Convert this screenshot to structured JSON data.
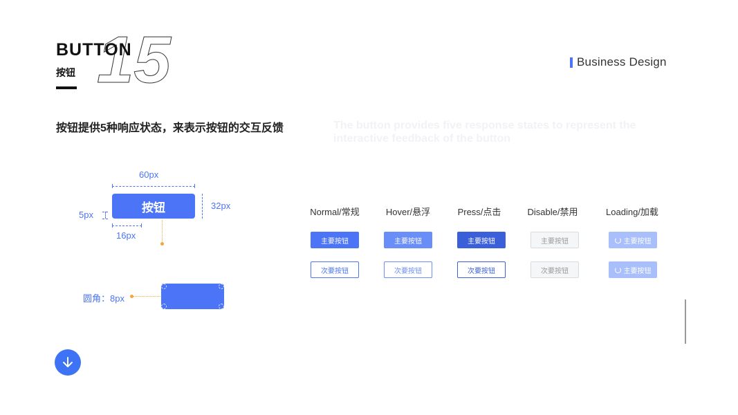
{
  "header": {
    "title": "BUTTON",
    "subtitle": "按钮",
    "number": "15",
    "brand": "Business Design"
  },
  "description": {
    "cn": "按钮提供5种响应状态，来表示按钮的交互反馈",
    "en": "The button provides five response states to represent the interactive feedback of the button"
  },
  "spec": {
    "width_label": "60px",
    "height_label": "32px",
    "gap_label": "5px",
    "padding_label": "16px",
    "button_label": "按钮",
    "radius_label": "圆角：8px"
  },
  "states": [
    {
      "label": "Normal/常规",
      "primary": "主要按钮",
      "secondary": "次要按钮"
    },
    {
      "label": "Hover/悬浮",
      "primary": "主要按钮",
      "secondary": "次要按钮"
    },
    {
      "label": "Press/点击",
      "primary": "主要按钮",
      "secondary": "次要按钮"
    },
    {
      "label": "Disable/禁用",
      "primary": "主要按钮",
      "secondary": "次要按钮"
    },
    {
      "label": "Loading/加载",
      "primary": "主要按钮",
      "secondary": "主要按钮"
    }
  ],
  "icons": {
    "scroll_down": "arrow-down-icon",
    "loading": "spinner-icon"
  },
  "colors": {
    "accent": "#4b74f6",
    "hover": "#6a8ef8",
    "press": "#3a5fd9",
    "loading": "#a9bffb",
    "marker": "#f4a63c"
  }
}
